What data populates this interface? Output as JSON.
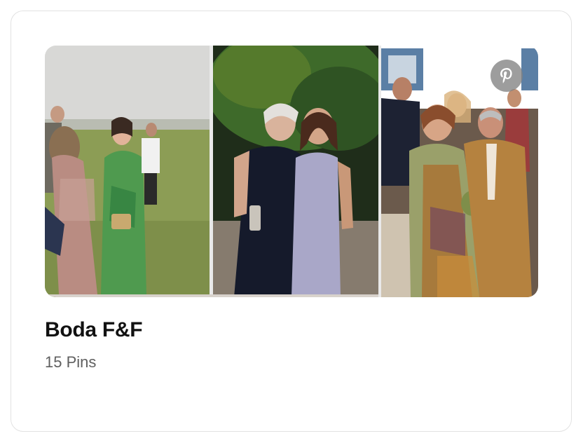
{
  "board": {
    "title": "Boda F&F",
    "pin_count": "15 Pins"
  },
  "photos": [
    {
      "icon": "photo-outdoor-lawn-guests"
    },
    {
      "icon": "photo-two-women-embracing"
    },
    {
      "icon": "photo-seated-ceremony-guests"
    }
  ],
  "badge": {
    "icon": "pinterest-icon"
  },
  "colors": {
    "title": "#111111",
    "subtitle": "#5f5f5f",
    "card_border": "#e2e2e2",
    "badge_bg": "#828282"
  }
}
